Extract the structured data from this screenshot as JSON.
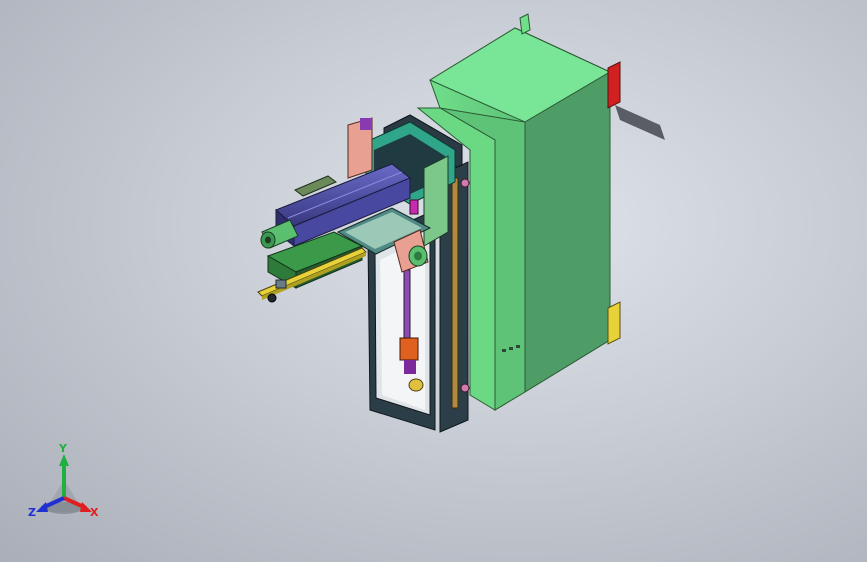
{
  "view": {
    "background_colors": [
      "#dfe3ea",
      "#a9aeb8"
    ],
    "model_colors": {
      "housing": "#63d37f",
      "housing_shadow": "#4a9a62",
      "arm_blue": "#4f4fa8",
      "dark_frame": "#253a44",
      "teal": "#2fa58a",
      "salmon": "#e7a092",
      "red_accent": "#d02020",
      "yellow_accent": "#e7d23a",
      "orange_accent": "#e06020",
      "magenta": "#c82ab0"
    }
  },
  "triad": {
    "x_label": "X",
    "y_label": "Y",
    "z_label": "Z",
    "x_color": "#e02020",
    "y_color": "#20b040",
    "z_color": "#2030d0"
  }
}
